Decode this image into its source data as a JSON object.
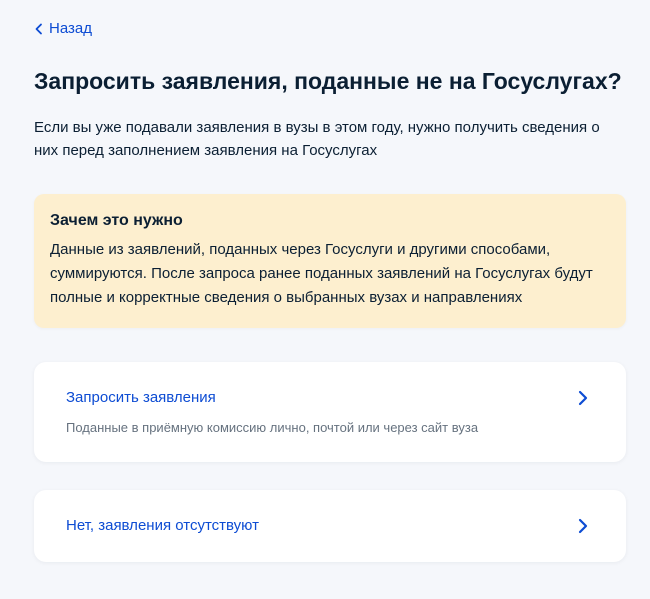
{
  "nav": {
    "back_label": "Назад"
  },
  "header": {
    "title": "Запросить заявления, поданные не на Госуслугах?",
    "lead": "Если вы уже подавали заявления в вузы в этом году, нужно получить сведения о них перед заполнением заявления на Госуслугах"
  },
  "info": {
    "title": "Зачем это нужно",
    "text": "Данные из заявлений, поданных через Госуслуги и другими способами, суммируются. После запроса ранее поданных заявлений на Госуслугах будут полные и корректные сведения о выбранных вузах и направлениях"
  },
  "options": [
    {
      "title": "Запросить заявления",
      "subtitle": "Поданные в приёмную комиссию лично, почтой или через сайт вуза"
    },
    {
      "title": "Нет, заявления отсутствуют"
    }
  ],
  "icons": {
    "back": "chevron-left-icon",
    "option": "chevron-right-icon"
  },
  "colors": {
    "link": "#0d4cd3",
    "background": "#f5f7fb",
    "info_background": "#fdefcf",
    "card_background": "#ffffff",
    "text": "#0b1f33",
    "muted": "#66727f"
  }
}
